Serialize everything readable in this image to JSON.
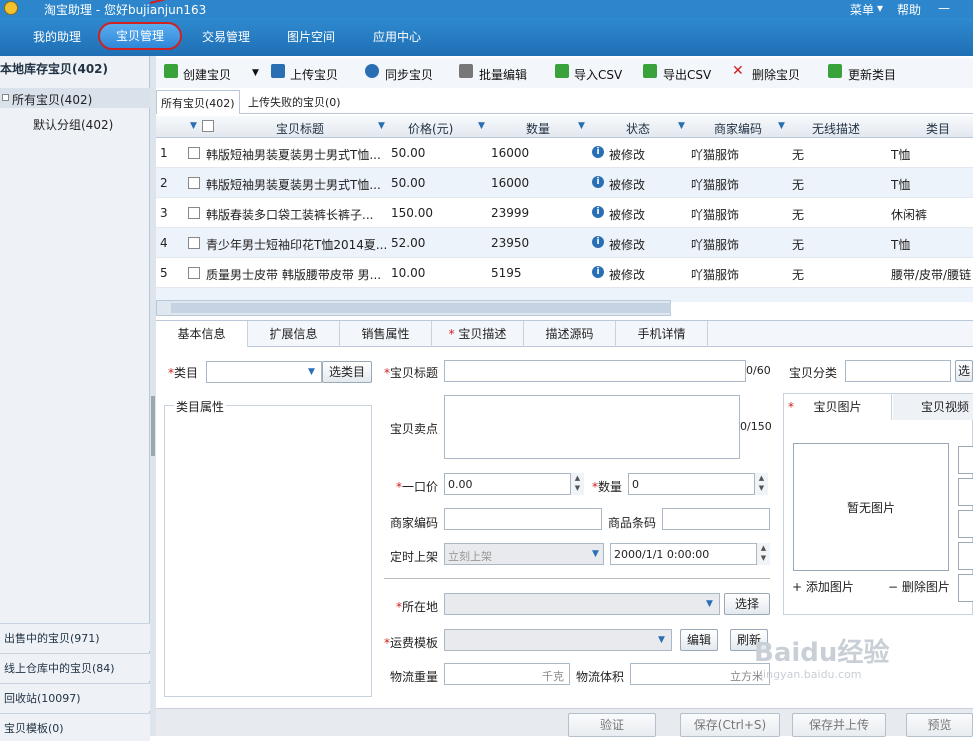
{
  "titlebar": {
    "title": "淘宝助理 - 您好bujianjun163",
    "menu": "菜单",
    "menu_arrow": "▾",
    "help": "帮助",
    "min": "—"
  },
  "nav": [
    "我的助理",
    "宝贝管理",
    "交易管理",
    "图片空间",
    "应用中心"
  ],
  "left": {
    "title": "本地库存宝贝(402)",
    "all": "所有宝贝(402)",
    "default": "默认分组(402)",
    "bottom": [
      "出售中的宝贝(971)",
      "线上仓库中的宝贝(84)",
      "回收站(10097)",
      "宝贝模板(0)"
    ]
  },
  "toolbar": {
    "create": "创建宝贝",
    "upload": "上传宝贝",
    "sync": "同步宝贝",
    "batch_edit": "批量编辑",
    "import_csv": "导入CSV",
    "export_csv": "导出CSV",
    "delete": "删除宝贝",
    "update_cat": "更新类目"
  },
  "subtabs": {
    "all": "所有宝贝(402)",
    "failed": "上传失败的宝贝(0)"
  },
  "grid": {
    "headers": [
      "宝贝标题",
      "价格(元)",
      "数量",
      "状态",
      "商家编码",
      "无线描述",
      "类目"
    ],
    "rows": [
      {
        "n": "1",
        "title": "韩版短袖男装夏装男士男式T恤...",
        "price": "50.00",
        "qty": "16000",
        "status": "被修改",
        "code": "吖猫服饰",
        "wireless": "无",
        "cat": "T恤"
      },
      {
        "n": "2",
        "title": "韩版短袖男装夏装男士男式T恤...",
        "price": "50.00",
        "qty": "16000",
        "status": "被修改",
        "code": "吖猫服饰",
        "wireless": "无",
        "cat": "T恤"
      },
      {
        "n": "3",
        "title": "韩版春装多口袋工装裤长裤子...",
        "price": "150.00",
        "qty": "23999",
        "status": "被修改",
        "code": "吖猫服饰",
        "wireless": "无",
        "cat": "休闲裤"
      },
      {
        "n": "4",
        "title": "青少年男士短袖印花T恤2014夏...",
        "price": "52.00",
        "qty": "23950",
        "status": "被修改",
        "code": "吖猫服饰",
        "wireless": "无",
        "cat": "T恤"
      },
      {
        "n": "5",
        "title": "质量男士皮带 韩版腰带皮带 男...",
        "price": "10.00",
        "qty": "5195",
        "status": "被修改",
        "code": "吖猫服饰",
        "wireless": "无",
        "cat": "腰带/皮带/腰链"
      }
    ]
  },
  "form": {
    "tabs": [
      "基本信息",
      "扩展信息",
      "销售属性",
      "宝贝描述",
      "描述源码",
      "手机详情"
    ],
    "category": "类目",
    "select_cat": "选类目",
    "cat_attr": "类目属性",
    "item_title": "宝贝标题",
    "title_count": "0/60",
    "item_group": "宝贝分类",
    "select": "选",
    "selling_point": "宝贝卖点",
    "sp_count": "0/150",
    "price": "一口价",
    "price_val": "0.00",
    "qty": "数量",
    "qty_val": "0",
    "merchant_code": "商家编码",
    "barcode": "商品条码",
    "schedule": "定时上架",
    "schedule_val": "立刻上架",
    "datetime": "2000/1/1 0:00:00",
    "location": "所在地",
    "choose": "选择",
    "shipping": "运费模板",
    "edit": "编辑",
    "refresh": "刷新",
    "weight": "物流重量",
    "weight_unit": "千克",
    "volume": "物流体积",
    "volume_unit": "立方米",
    "pic_tab": "宝贝图片",
    "video_tab": "宝贝视频",
    "no_pic": "暂无图片",
    "add_pic": "添加图片",
    "del_pic": "删除图片"
  },
  "bottom": {
    "verify": "验证",
    "save": "保存(Ctrl+S)",
    "save_upload": "保存并上传",
    "preview": "预览"
  },
  "watermark": "Baidu经验",
  "watermark_url": "jingyan.baidu.com"
}
